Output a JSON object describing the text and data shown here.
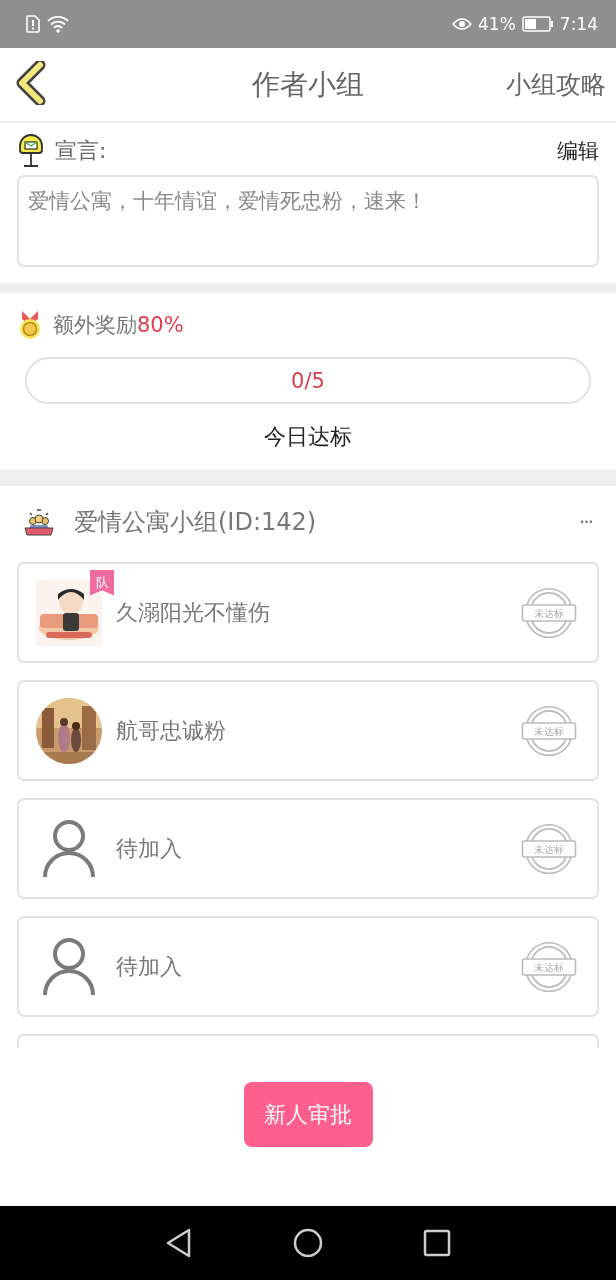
{
  "status_bar": {
    "battery": "41%",
    "time": "7:14"
  },
  "header": {
    "title": "作者小组",
    "action": "小组攻略"
  },
  "declaration": {
    "label": "宣言:",
    "edit": "编辑",
    "text": "爱情公寓，十年情谊，爱情死忠粉，速来！"
  },
  "bonus": {
    "label": "额外奖励",
    "percent": "80%",
    "progress": "0/5",
    "level": 0,
    "caption": "今日达标"
  },
  "group": {
    "title": "爱情公寓小组(ID:142)",
    "more": "···"
  },
  "members": [
    {
      "name": "久溺阳光不懂伤",
      "badge": "队",
      "stamp": "未达标"
    },
    {
      "name": "航哥忠诚粉",
      "stamp": "未达标"
    },
    {
      "kind": "placeholder",
      "name": "待加入",
      "stamp": "未达标"
    },
    {
      "kind": "placeholder",
      "name": "待加入",
      "stamp": "未达标"
    }
  ],
  "approve_button": "新人审批"
}
